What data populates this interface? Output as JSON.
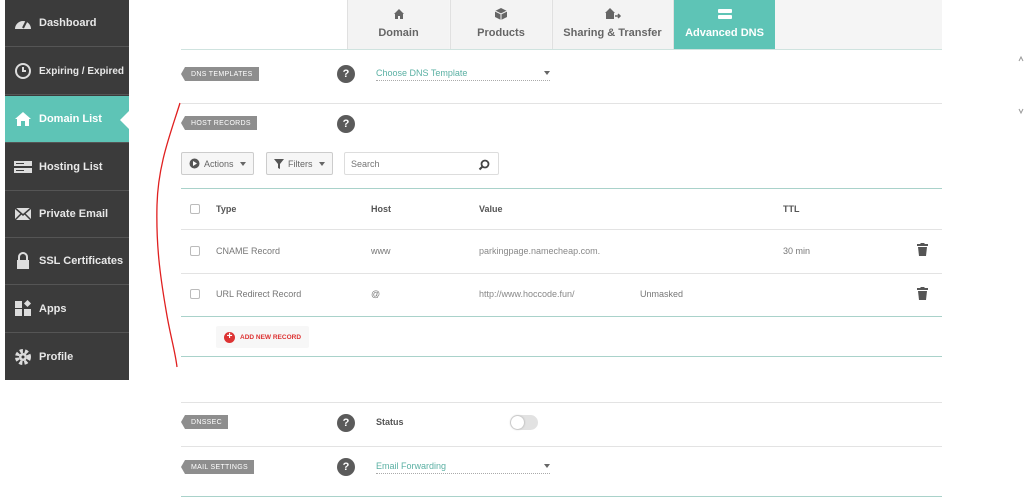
{
  "sidebar": {
    "items": [
      {
        "label": "Dashboard",
        "icon": "dashboard-icon"
      },
      {
        "label": "Expiring / Expired",
        "icon": "clock-icon"
      },
      {
        "label": "Domain List",
        "icon": "home-icon",
        "active": true
      },
      {
        "label": "Hosting List",
        "icon": "server-icon"
      },
      {
        "label": "Private Email",
        "icon": "envelope-icon"
      },
      {
        "label": "SSL Certificates",
        "icon": "lock-icon"
      },
      {
        "label": "Apps",
        "icon": "apps-icon"
      },
      {
        "label": "Profile",
        "icon": "gear-icon"
      }
    ]
  },
  "tabs": [
    {
      "label": "Domain",
      "icon": "home-icon"
    },
    {
      "label": "Products",
      "icon": "box-icon"
    },
    {
      "label": "Sharing & Transfer",
      "icon": "share-icon"
    },
    {
      "label": "Advanced DNS",
      "icon": "dns-icon",
      "active": true
    }
  ],
  "dns_templates": {
    "label": "DNS TEMPLATES",
    "dropdown": "Choose DNS Template"
  },
  "host_records": {
    "label": "HOST RECORDS",
    "actions_label": "Actions",
    "filters_label": "Filters",
    "search_placeholder": "Search",
    "columns": {
      "type": "Type",
      "host": "Host",
      "value": "Value",
      "ttl": "TTL"
    },
    "rows": [
      {
        "type": "CNAME Record",
        "host": "www",
        "value": "parkingpage.namecheap.com.",
        "extra": "",
        "ttl": "30 min"
      },
      {
        "type": "URL Redirect Record",
        "host": "@",
        "value": "http://www.hoccode.fun/",
        "extra": "Unmasked",
        "ttl": ""
      }
    ],
    "add_label": "ADD NEW RECORD"
  },
  "dnssec": {
    "label": "DNSSEC",
    "status_label": "Status",
    "enabled": false
  },
  "mail_settings": {
    "label": "MAIL SETTINGS",
    "dropdown": "Email Forwarding"
  },
  "colors": {
    "accent": "#5ec4b6",
    "sidebar_bg": "#3b3b3b",
    "add_red": "#dd3333",
    "annotation_red": "#e02020"
  }
}
